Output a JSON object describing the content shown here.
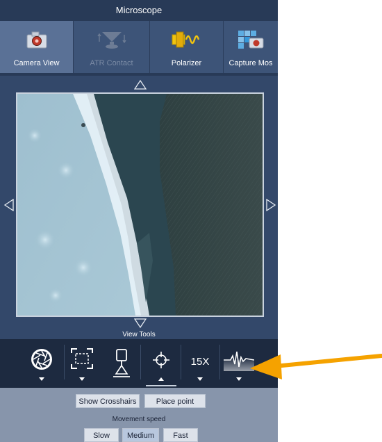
{
  "window": {
    "title": "Microscope"
  },
  "ribbon": {
    "tabs": [
      {
        "label": "Camera View",
        "icon": "camera-icon",
        "active": true,
        "enabled": true
      },
      {
        "label": "ATR Contact",
        "icon": "atr-contact-icon",
        "active": false,
        "enabled": false
      },
      {
        "label": "Polarizer",
        "icon": "polarizer-icon",
        "active": false,
        "enabled": true
      },
      {
        "label": "Capture Mos",
        "icon": "capture-mosaic-icon",
        "active": false,
        "enabled": true
      }
    ]
  },
  "camera_view": {
    "nav": [
      "arrow-up-icon",
      "arrow-down-icon",
      "arrow-left-icon",
      "arrow-right-icon"
    ]
  },
  "view_tools": {
    "label": "View Tools",
    "tools": [
      {
        "name": "aperture-icon",
        "has_dropdown": true
      },
      {
        "name": "region-select-icon",
        "has_dropdown": true
      },
      {
        "name": "illumination-icon",
        "has_dropdown": false
      },
      {
        "name": "crosshair-icon",
        "has_dropdown": true,
        "expanded": true
      },
      {
        "name": "zoom-select",
        "value": "15X",
        "has_dropdown": true
      },
      {
        "name": "spectrum-icon",
        "has_dropdown": true
      }
    ]
  },
  "buttons": {
    "show_crosshairs": "Show Crosshairs",
    "place_point": "Place point"
  },
  "movement_speed": {
    "label": "Movement speed",
    "options": [
      "Slow",
      "Medium",
      "Fast"
    ],
    "selected": "Medium"
  },
  "colors": {
    "panel": "#33486a",
    "title_bar": "#283a57",
    "tools_bar": "#1d2a40",
    "highlight_arrow": "#f5a200"
  }
}
